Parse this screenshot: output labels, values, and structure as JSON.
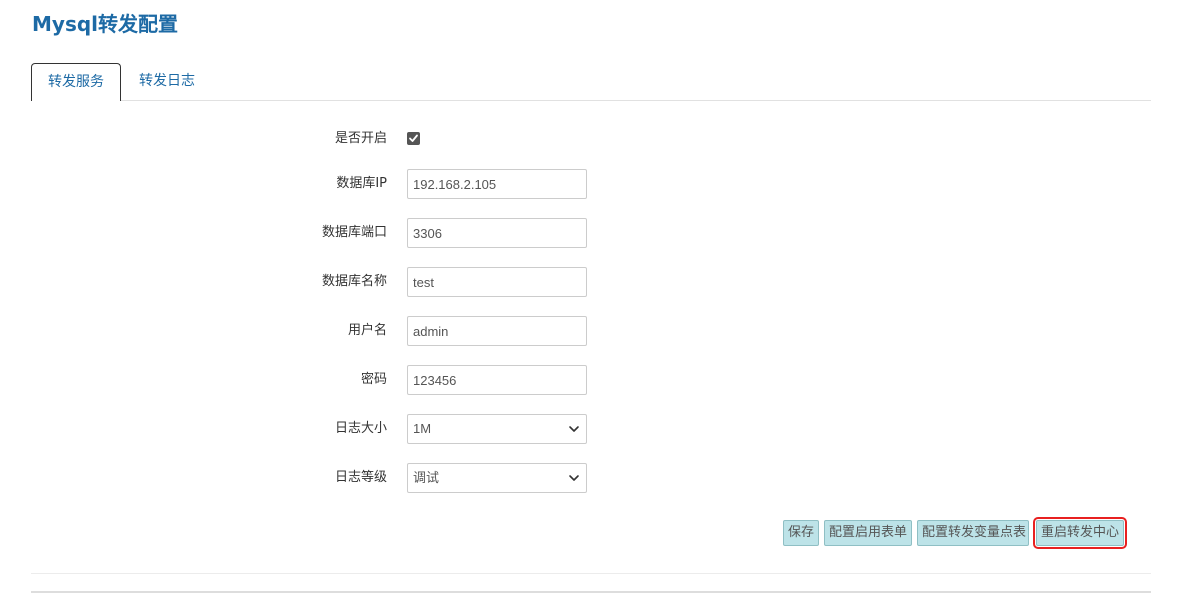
{
  "page": {
    "title": "Mysql转发配置"
  },
  "tabs": [
    {
      "label": "转发服务",
      "active": true
    },
    {
      "label": "转发日志",
      "active": false
    }
  ],
  "form": {
    "enabled": {
      "label": "是否开启",
      "checked": true
    },
    "db_ip": {
      "label": "数据库IP",
      "value": "192.168.2.105"
    },
    "db_port": {
      "label": "数据库端口",
      "value": "3306"
    },
    "db_name": {
      "label": "数据库名称",
      "value": "test"
    },
    "username": {
      "label": "用户名",
      "value": "admin"
    },
    "password": {
      "label": "密码",
      "value": "123456"
    },
    "log_size": {
      "label": "日志大小",
      "value": "1M"
    },
    "log_level": {
      "label": "日志等级",
      "value": "调试"
    }
  },
  "actions": {
    "save": "保存",
    "configure_enable_table": "配置启用表单",
    "configure_variable_points": "配置转发变量点表",
    "restart_center": "重启转发中心"
  },
  "colors": {
    "title": "#1d6aa5",
    "button_bg": "#bde3e8",
    "highlight": "#e82020"
  },
  "icons": {
    "checkbox": "checkmark-icon",
    "select": "chevron-down-icon"
  }
}
